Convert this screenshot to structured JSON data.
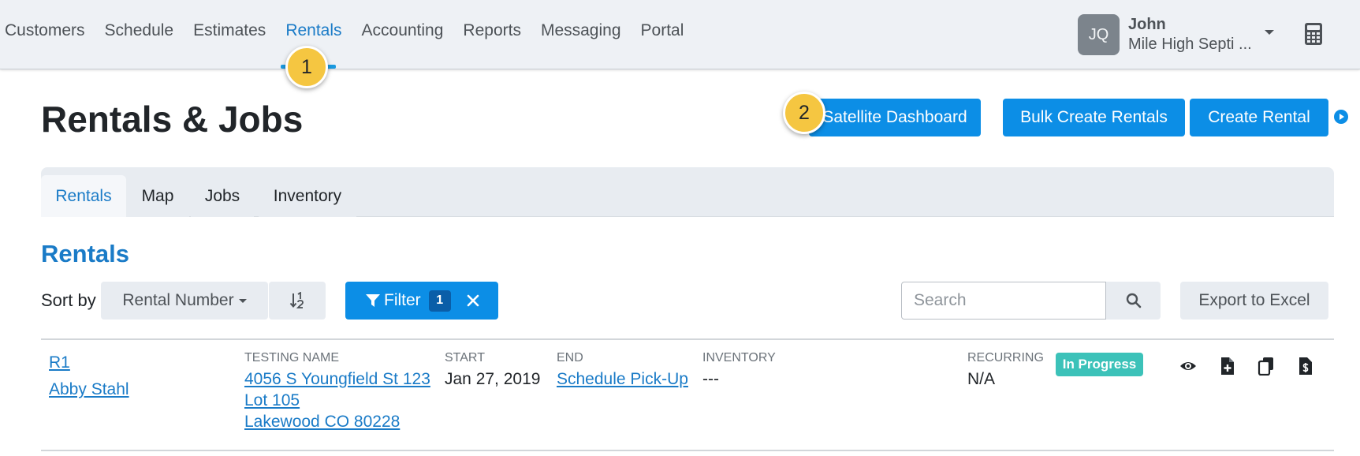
{
  "nav": {
    "items": [
      {
        "label": "Customers"
      },
      {
        "label": "Schedule"
      },
      {
        "label": "Estimates"
      },
      {
        "label": "Rentals",
        "active": true
      },
      {
        "label": "Accounting"
      },
      {
        "label": "Reports"
      },
      {
        "label": "Messaging"
      },
      {
        "label": "Portal"
      }
    ],
    "callout_1": "1"
  },
  "user": {
    "initials": "JQ",
    "name": "John",
    "company": "Mile High Septi ..."
  },
  "header": {
    "title": "Rentals & Jobs",
    "callout_2": "2",
    "satellite_label": "Satellite Dashboard",
    "bulk_label": "Bulk Create Rentals",
    "create_label": "Create Rental"
  },
  "tabs": [
    {
      "label": "Rentals",
      "active": true
    },
    {
      "label": "Map"
    },
    {
      "label": "Jobs"
    },
    {
      "label": "Inventory"
    }
  ],
  "section": {
    "title": "Rentals"
  },
  "controls": {
    "sort_label": "Sort by",
    "sort_value": "Rental Number",
    "filter_label": "Filter",
    "filter_count": "1",
    "search_placeholder": "Search",
    "export_label": "Export to Excel"
  },
  "rows": [
    {
      "rental_number": "R1",
      "customer": "Abby Stahl",
      "site_label": "TESTING NAME",
      "address_line1": "4056 S Youngfield St 123",
      "address_line2": "Lot 105",
      "address_line3": "Lakewood CO 80228",
      "start_label": "START",
      "start_value": "Jan 27, 2019",
      "end_label": "END",
      "end_value": "Schedule Pick-Up",
      "inventory_label": "INVENTORY",
      "inventory_value": "---",
      "recurring_label": "RECURRING",
      "recurring_value": "N/A",
      "status": "In Progress"
    }
  ],
  "colors": {
    "primary": "#0c8ee6",
    "accent_text": "#1a7bc7",
    "status_in_progress": "#3cc2b9",
    "callout": "#f5c641"
  },
  "icons": [
    "calculator-icon",
    "play-circle-icon",
    "sort-numeric-icon",
    "filter-icon",
    "close-icon",
    "search-icon",
    "eye-icon",
    "file-plus-icon",
    "copy-icon",
    "file-invoice-icon"
  ]
}
